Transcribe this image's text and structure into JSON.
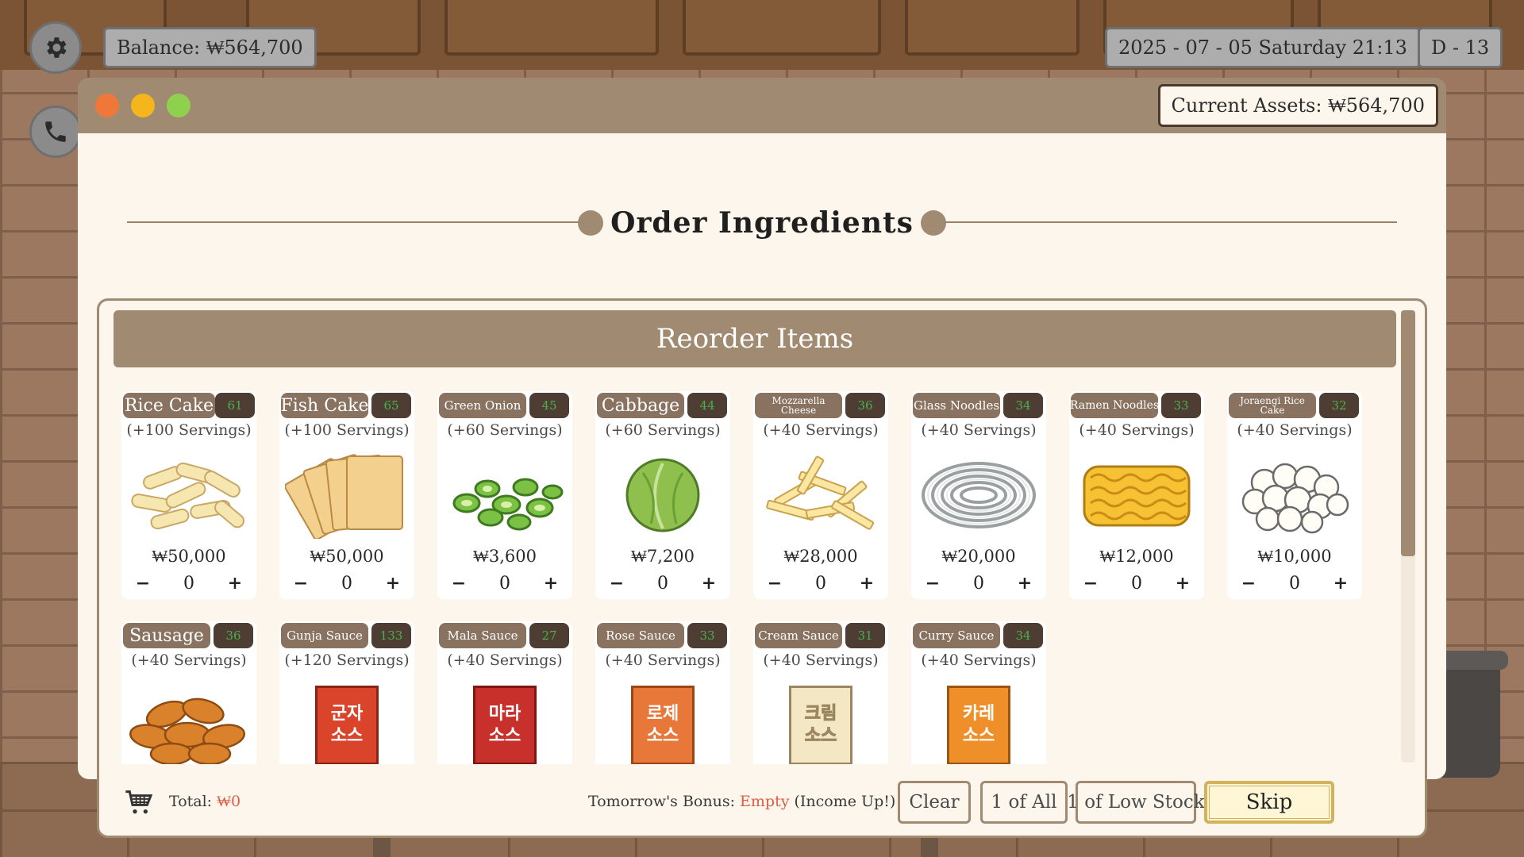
{
  "hud": {
    "balance": "Balance: ₩564,700",
    "datetime": "2025 - 07 - 05 Saturday 21:13",
    "day": "D - 13"
  },
  "window": {
    "current_assets": "Current Assets: ₩564,700",
    "title": "Order Ingredients",
    "section_title": "Reorder Items"
  },
  "items": [
    {
      "name": "Rice Cake",
      "stock": "61",
      "servings": "(+100 Servings)",
      "price": "₩50,000",
      "qty": "0",
      "icon": "rice-cake-icon"
    },
    {
      "name": "Fish Cake",
      "stock": "65",
      "servings": "(+100 Servings)",
      "price": "₩50,000",
      "qty": "0",
      "icon": "fish-cake-icon"
    },
    {
      "name": "Green Onion",
      "stock": "45",
      "servings": "(+60 Servings)",
      "price": "₩3,600",
      "qty": "0",
      "icon": "green-onion-icon"
    },
    {
      "name": "Cabbage",
      "stock": "44",
      "servings": "(+60 Servings)",
      "price": "₩7,200",
      "qty": "0",
      "icon": "cabbage-icon"
    },
    {
      "name": "Mozzarella Cheese",
      "stock": "36",
      "servings": "(+40 Servings)",
      "price": "₩28,000",
      "qty": "0",
      "icon": "mozzarella-cheese-icon"
    },
    {
      "name": "Glass Noodles",
      "stock": "34",
      "servings": "(+40 Servings)",
      "price": "₩20,000",
      "qty": "0",
      "icon": "glass-noodles-icon"
    },
    {
      "name": "Ramen Noodles",
      "stock": "33",
      "servings": "(+40 Servings)",
      "price": "₩12,000",
      "qty": "0",
      "icon": "ramen-noodles-icon"
    },
    {
      "name": "Joraengi Rice Cake",
      "stock": "32",
      "servings": "(+40 Servings)",
      "price": "₩10,000",
      "qty": "0",
      "icon": "joraengi-rice-cake-icon"
    },
    {
      "name": "Sausage",
      "stock": "36",
      "servings": "(+40 Servings)",
      "icon": "sausage-icon"
    },
    {
      "name": "Gunja Sauce",
      "stock": "133",
      "servings": "(+120 Servings)",
      "icon": "gunja-sauce-icon",
      "pack_label_1": "군자",
      "pack_label_2": "소스",
      "pack_color": "#d9442a"
    },
    {
      "name": "Mala Sauce",
      "stock": "27",
      "servings": "(+40 Servings)",
      "icon": "mala-sauce-icon",
      "pack_label_1": "마라",
      "pack_label_2": "소스",
      "pack_color": "#c8312b"
    },
    {
      "name": "Rose Sauce",
      "stock": "33",
      "servings": "(+40 Servings)",
      "icon": "rose-sauce-icon",
      "pack_label_1": "로제",
      "pack_label_2": "소스",
      "pack_color": "#e8783a"
    },
    {
      "name": "Cream Sauce",
      "stock": "31",
      "servings": "(+40 Servings)",
      "icon": "cream-sauce-icon",
      "pack_label_1": "크림",
      "pack_label_2": "소스",
      "pack_color": "#f4e7c4"
    },
    {
      "name": "Curry Sauce",
      "stock": "34",
      "servings": "(+40 Servings)",
      "icon": "curry-sauce-icon",
      "pack_label_1": "카레",
      "pack_label_2": "소스",
      "pack_color": "#ee8f2a"
    }
  ],
  "footer": {
    "total_label": "Total:",
    "total_value": "₩0",
    "bonus_label": "Tomorrow's Bonus:",
    "bonus_value": "Empty",
    "bonus_suffix": "(Income Up!)",
    "clear": "Clear",
    "one_of_all": "1 of All",
    "one_of_low_stock": "1 of Low Stock",
    "skip": "Skip"
  },
  "colors": {
    "window_frame": "#a08a72",
    "panel_bg": "#fcf6ec",
    "stock_text": "#4caf50",
    "accent_red": "#e05b45",
    "dot_red": "#f0773a",
    "dot_yellow": "#f5b51c",
    "dot_green": "#8fd14f"
  }
}
